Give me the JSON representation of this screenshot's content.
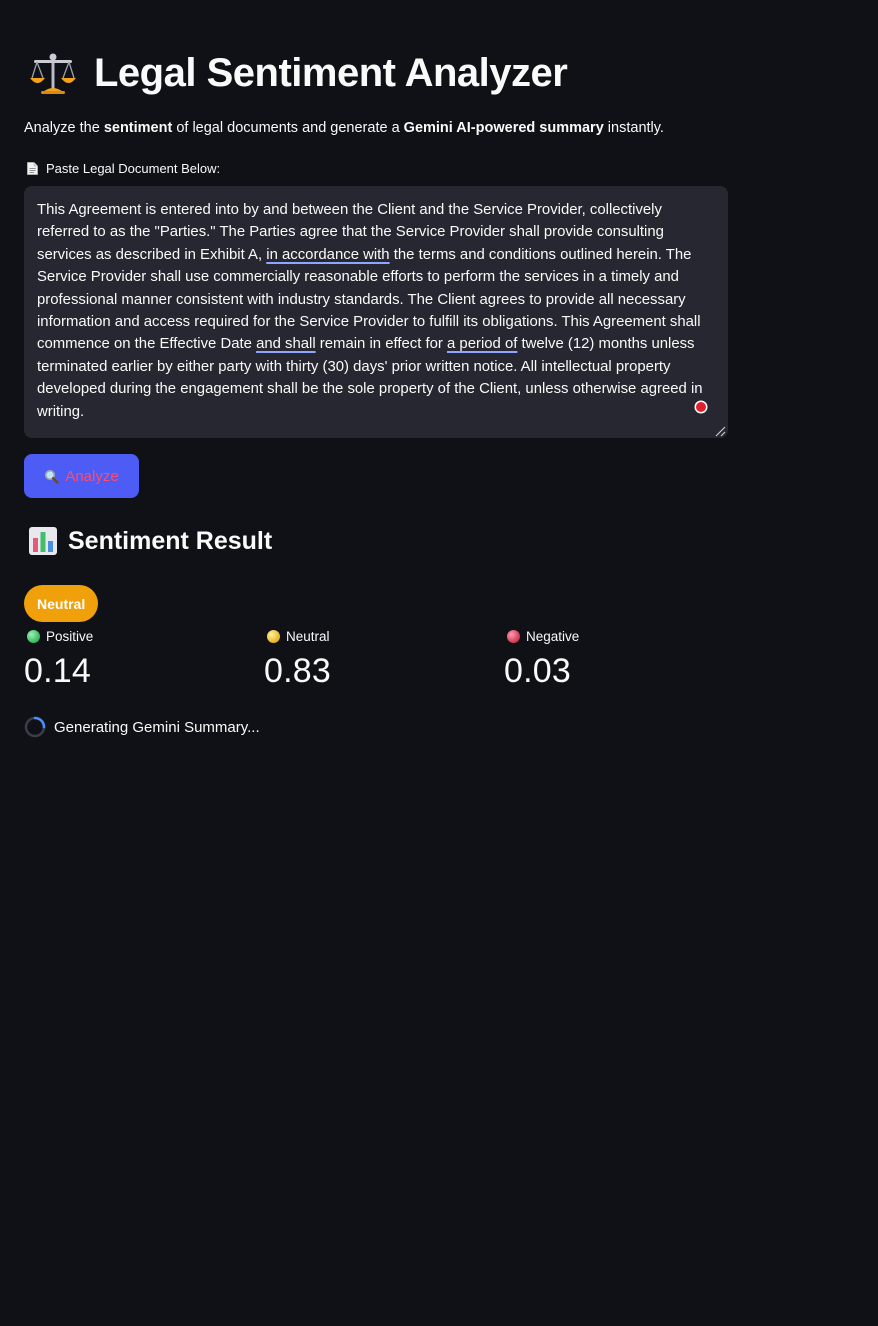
{
  "header": {
    "icon": "balance-scale-icon",
    "title": "Legal Sentiment Analyzer",
    "subtitle_parts": {
      "p1": "Analyze the ",
      "b1": "sentiment",
      "p2": " of legal documents and generate a ",
      "b2": "Gemini AI-powered summary",
      "p3": " instantly."
    }
  },
  "input": {
    "label": "Paste Legal Document Below:",
    "label_icon": "document-icon",
    "text_parts": {
      "t1": "This Agreement is entered into by and between the Client and the Service Provider, collectively referred to as the \"Parties.\" The Parties agree that the Service Provider shall provide consulting services as described in Exhibit A, ",
      "u1": "in accordance with",
      "t2": " the terms and conditions outlined herein. The Service Provider shall use commercially reasonable efforts to perform the services in a timely and professional manner consistent with industry standards. The Client agrees to provide all necessary information and access required for the Service Provider to fulfill its obligations. This Agreement shall commence on the Effective Date ",
      "u2": "and shall",
      "t3": " remain in effect for ",
      "u3": "a period of",
      "t4": " twelve (12) months unless terminated earlier by either party with thirty (30) days' prior written notice. All intellectual property developed during the engagement shall be the sole property of the Client, unless otherwise agreed in writing."
    }
  },
  "analyze_button": {
    "icon": "magnifier-icon",
    "label": "Analyze"
  },
  "result": {
    "icon": "bar-chart-icon",
    "title": "Sentiment Result",
    "badge": "Neutral",
    "metrics": [
      {
        "label": "Positive",
        "value": "0.14",
        "color": "#3fcf6b"
      },
      {
        "label": "Neutral",
        "value": "0.83",
        "color": "#f5c542"
      },
      {
        "label": "Negative",
        "value": "0.03",
        "color": "#e0405a"
      }
    ],
    "status": "Generating Gemini Summary..."
  },
  "colors": {
    "background": "#0f1116",
    "textarea": "#262730",
    "button": "#4c5cf5",
    "button_text": "#ff4b6e",
    "badge": "#f0a00b"
  }
}
